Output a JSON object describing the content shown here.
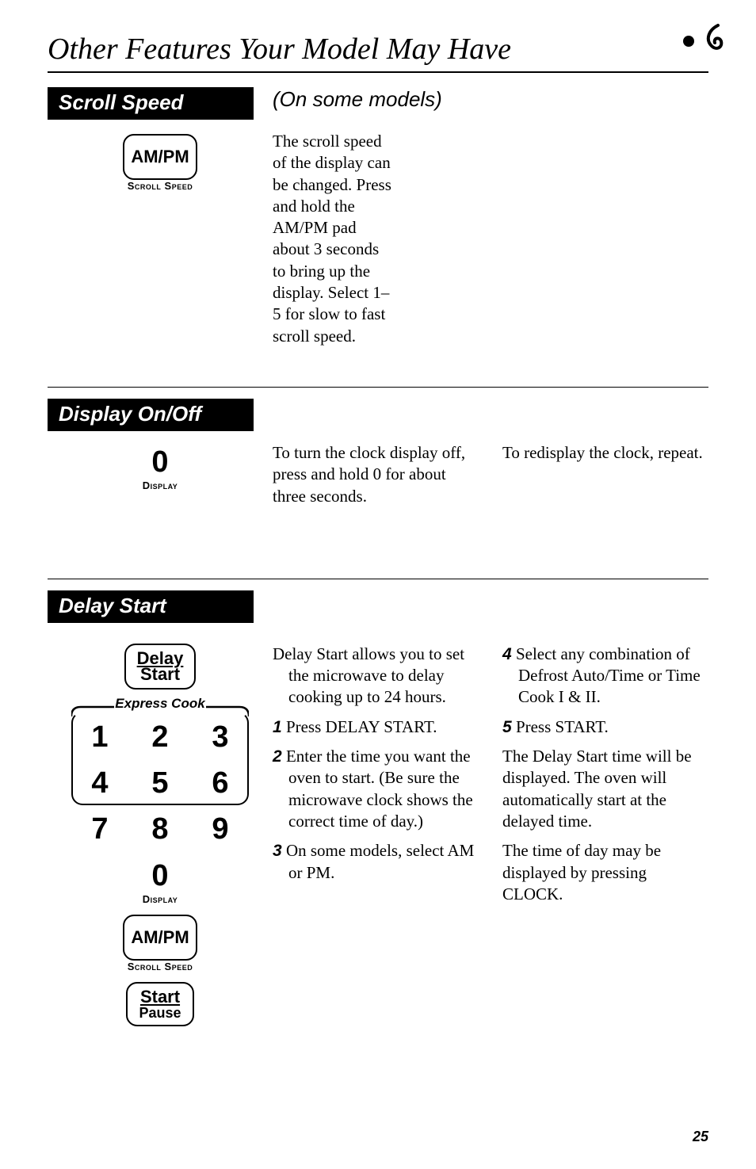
{
  "page": {
    "title": "Other Features Your Model May Have",
    "number": "25"
  },
  "corner": {
    "dot_name": "bullet-icon",
    "swirl_name": "swirl-logo-icon"
  },
  "scroll_speed": {
    "header": "Scroll Speed",
    "subtitle": "(On some models)",
    "body": "The scroll speed of the display can be changed. Press and hold the AM/PM pad about 3 seconds to bring up the display. Select 1–5 for slow to fast scroll speed.",
    "btn_label": "AM/PM",
    "btn_caption": "Scroll Speed"
  },
  "display_onoff": {
    "header": "Display On/Off",
    "left_text": "To turn the clock display off, press and hold 0 for about three seconds.",
    "right_text": "To redisplay the clock, repeat.",
    "digit": "0",
    "caption": "Display"
  },
  "delay_start": {
    "header": "Delay Start",
    "intro": "Delay Start allows you to set the microwave to delay cooking up to 24 hours.",
    "steps_left": [
      {
        "n": "1",
        "t": "Press DELAY START."
      },
      {
        "n": "2",
        "t": "Enter the time you want the oven to start. (Be sure the microwave clock shows the correct time of day.)"
      },
      {
        "n": "3",
        "t": "On some models, select AM or PM."
      }
    ],
    "steps_right": [
      {
        "n": "4",
        "t": "Select any combination of Defrost Auto/Time or Time Cook I & II."
      },
      {
        "n": "5",
        "t": "Press START."
      }
    ],
    "after1": "The Delay Start time will be displayed. The oven will automatically start at the delayed time.",
    "after2": "The time of day may be displayed by pressing CLOCK.",
    "btn_delay_l1": "Delay",
    "btn_delay_l2": "Start",
    "express_label": "Express Cook",
    "digits": [
      "1",
      "2",
      "3",
      "4",
      "5",
      "6",
      "7",
      "8",
      "9"
    ],
    "zero": "0",
    "zero_caption": "Display",
    "ampm_label": "AM/PM",
    "ampm_caption": "Scroll Speed",
    "start_l1": "Start",
    "start_l2": "Pause"
  }
}
